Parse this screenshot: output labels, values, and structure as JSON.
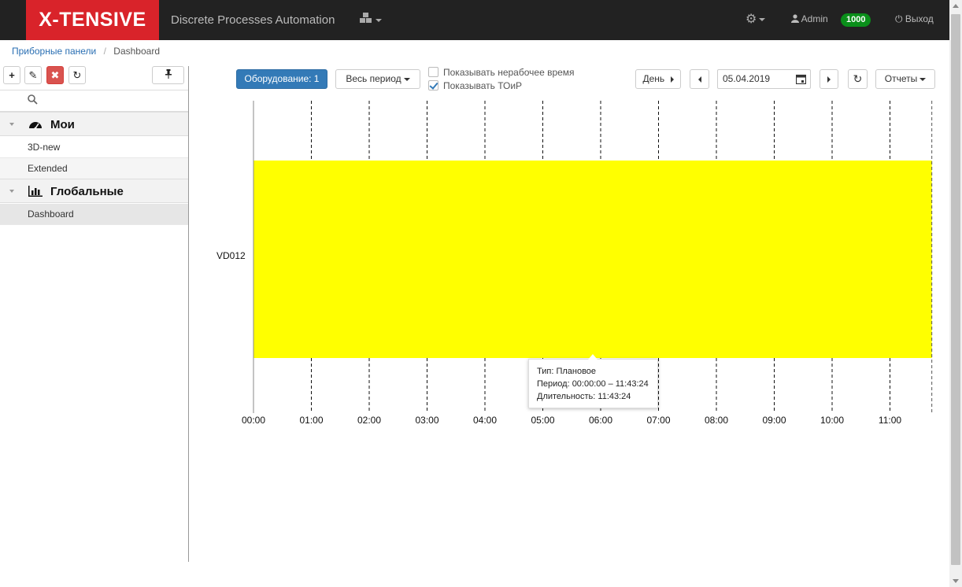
{
  "navbar": {
    "logo": "X-TENSIVE",
    "app_title": "Discrete Processes Automation",
    "user": "Admin",
    "badge": "1000",
    "logout": "Выход",
    "icons": [
      "cubes-icon",
      "gear-icon",
      "user-icon",
      "power-icon"
    ]
  },
  "breadcrumb": {
    "parent": "Приборные панели",
    "current": "Dashboard"
  },
  "sidebar": {
    "groups": [
      {
        "label": "Мои",
        "icon": "dashboard-icon",
        "items": [
          "3D-new",
          "Extended"
        ]
      },
      {
        "label": "Глобальные",
        "icon": "bar-chart-icon",
        "items": [
          "Dashboard"
        ]
      }
    ],
    "active_item": "Dashboard"
  },
  "toolbar": {
    "equipment_label": "Оборудование: 1",
    "period_label": "Весь период",
    "show_nonworking": "Показывать нерабочее время",
    "show_nonworking_checked": false,
    "show_toir": "Показывать ТОиР",
    "show_toir_checked": true,
    "scale_label": "День",
    "date_value": "05.04.2019",
    "reports_label": "Отчеты"
  },
  "chart_data": {
    "type": "bar",
    "orientation": "horizontal-timeline",
    "categories": [
      "VD012"
    ],
    "x_ticks": [
      "00:00",
      "01:00",
      "02:00",
      "03:00",
      "04:00",
      "05:00",
      "06:00",
      "07:00",
      "08:00",
      "09:00",
      "10:00",
      "11:00"
    ],
    "xlim": [
      "00:00",
      "11:43:24"
    ],
    "grid": "vertical-dashed",
    "segments": [
      {
        "row": "VD012",
        "start": "00:00:00",
        "end": "11:43:24",
        "color": "#ffff00",
        "type": "Плановое"
      }
    ],
    "tooltip": {
      "type": "Тип: Плановое",
      "period": "Период: 00:00:00 – 11:43:24",
      "duration": "Длительность: 11:43:24"
    }
  }
}
